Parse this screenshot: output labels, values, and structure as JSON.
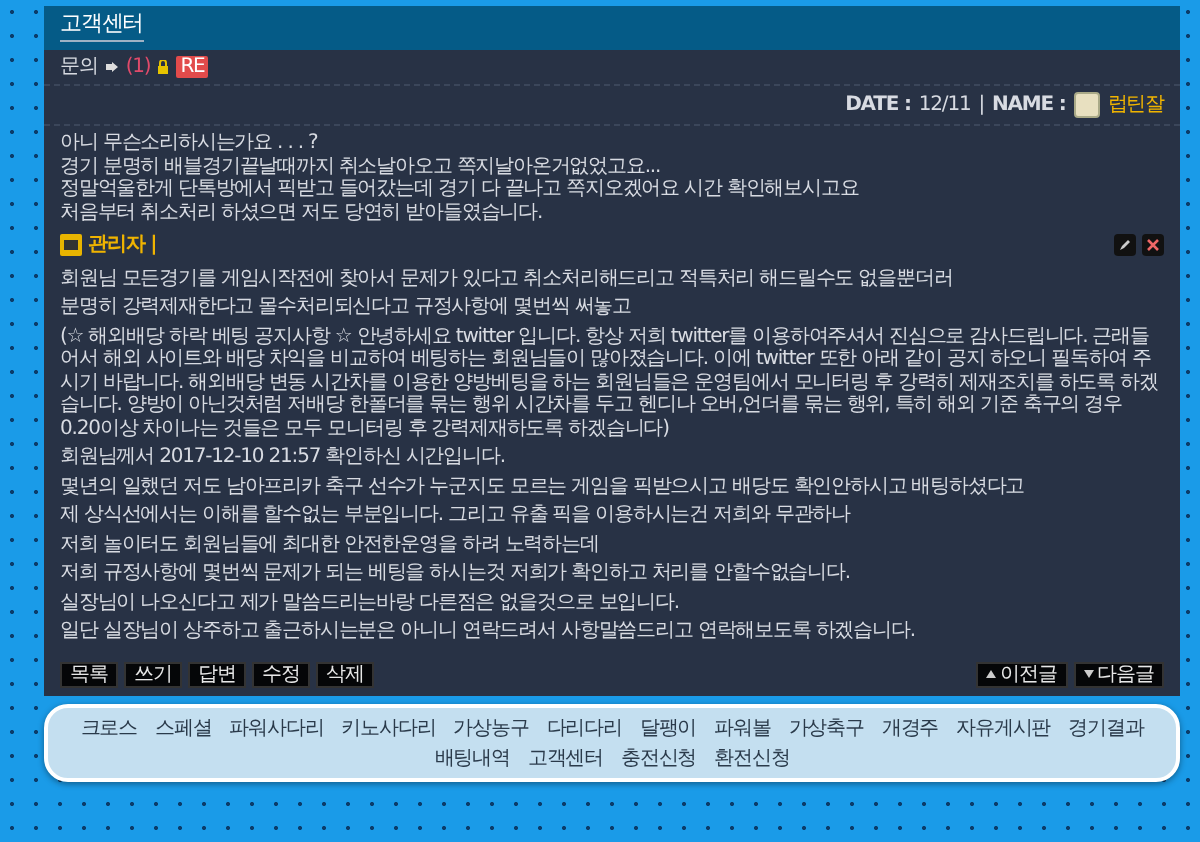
{
  "header": {
    "title": "고객센터"
  },
  "inquiry": {
    "label": "문의",
    "count": "(1)",
    "locked": true,
    "badge": "RE"
  },
  "meta": {
    "date_label": "DATE :",
    "date": "12/11",
    "separator": "|",
    "name_label": "NAME :",
    "name": "럽틴잘"
  },
  "question": [
    "아니 무슨소리하시는가요 . . . ?",
    "경기 분명히 배블경기끝날때까지 취소날아오고 쪽지날아온거없었고요...",
    "정말억울한게 단톡방에서 픽받고 들어갔는데 경기 다 끝나고 쪽지오겠어요 시간 확인해보시고요",
    "처음부터 취소처리 하셨으면 저도 당연히 받아들였습니다."
  ],
  "reply": {
    "author": "관리자 |",
    "paragraphs": [
      "회원님 모든경기를 게임시작전에 찾아서 문제가 있다고 취소처리해드리고 적특처리 해드릴수도 없을뿐더러",
      "분명히 강력제재한다고 몰수처리되신다고 규정사항에 몇번씩 써놓고",
      "(☆ 해외배당 하락 베팅 공지사항 ☆ 안녕하세요 twitter 입니다. 항상 저희 twitter를 이용하여주셔서 진심으로 감사드립니다. 근래들어서 해외 사이트와 배당 차익을 비교하여 베팅하는 회원님들이 많아졌습니다. 이에 twitter 또한 아래 같이 공지 하오니 필독하여 주시기 바랍니다. 해외배당 변동 시간차를 이용한 양방베팅을 하는 회원님들은 운영팀에서 모니터링 후 강력히 제재조치를 하도록 하겠습니다. 양방이 아닌것처럼 저배당 한폴더를 묶는 행위 시간차를 두고 헨디나 오버,언더를 묶는 행위, 특히 해외 기준 축구의 경우 0.20이상 차이나는 것들은 모두 모니터링 후 강력제재하도록 하겠습니다)",
      "회원님께서 2017-12-10 21:57 확인하신 시간입니다.",
      "몇년의 일했던 저도 남아프리카 축구 선수가 누군지도 모르는 게임을 픽받으시고 배당도 확인안하시고 배팅하셨다고",
      "제 상식선에서는 이해를 할수없는 부분입니다.  그리고 유출 픽을 이용하시는건 저희와 무관하나",
      "저희 놀이터도 회원님들에 최대한 안전한운영을 하려 노력하는데",
      "저희 규정사항에 몇번씩 문제가 되는 베팅을 하시는것 저희가 확인하고 처리를 안할수없습니다.",
      "실장님이 나오신다고 제가 말씀드리는바랑 다른점은 없을것으로 보입니다.",
      "일단 실장님이 상주하고 출근하시는분은 아니니 연락드려서 사항말씀드리고 연락해보도록 하겠습니다."
    ]
  },
  "buttons": [
    "목록",
    "쓰기",
    "답변",
    "수정",
    "삭제"
  ],
  "pager": [
    "이전글",
    "다음글"
  ],
  "nav": [
    {
      "label": "크로스",
      "selected": false
    },
    {
      "label": "스페셜",
      "selected": false
    },
    {
      "label": "파워사다리",
      "selected": false
    },
    {
      "label": "키노사다리",
      "selected": false
    },
    {
      "label": "가상농구",
      "selected": false
    },
    {
      "label": "다리다리",
      "selected": false
    },
    {
      "label": "달팽이",
      "selected": false
    },
    {
      "label": "파워볼",
      "selected": false
    },
    {
      "label": "가상축구",
      "selected": false
    },
    {
      "label": "개경주",
      "selected": false
    },
    {
      "label": "자유게시판",
      "selected": false
    },
    {
      "label": "경기결과",
      "selected": false
    },
    {
      "label": "배팅내역",
      "selected": false
    },
    {
      "label": "고객센터",
      "selected": false
    },
    {
      "label": "충전신청",
      "selected": false
    },
    {
      "label": "환전신청",
      "selected": false
    }
  ]
}
